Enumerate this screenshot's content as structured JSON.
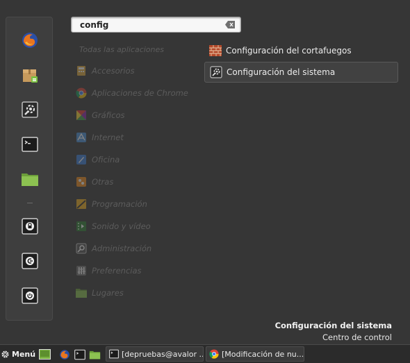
{
  "search": {
    "value": "config",
    "clear_icon": "backspace-clear-icon"
  },
  "favorites": [
    {
      "name": "firefox",
      "icon": "firefox-icon"
    },
    {
      "name": "software-manager",
      "icon": "package-icon"
    },
    {
      "name": "system-settings",
      "icon": "settings-icon"
    },
    {
      "name": "terminal",
      "icon": "terminal-icon"
    },
    {
      "name": "files",
      "icon": "folder-icon"
    },
    {
      "name": "lock-screen",
      "icon": "lock-icon"
    },
    {
      "name": "logout",
      "icon": "logout-icon"
    },
    {
      "name": "shutdown",
      "icon": "power-icon"
    }
  ],
  "categories": {
    "all_label": "Todas las aplicaciones",
    "items": [
      {
        "label": "Accesorios",
        "icon": "accessories-icon"
      },
      {
        "label": "Aplicaciones de Chrome",
        "icon": "chrome-icon"
      },
      {
        "label": "Gráficos",
        "icon": "graphics-icon"
      },
      {
        "label": "Internet",
        "icon": "internet-icon"
      },
      {
        "label": "Oficina",
        "icon": "office-icon"
      },
      {
        "label": "Otras",
        "icon": "other-icon"
      },
      {
        "label": "Programación",
        "icon": "programming-icon"
      },
      {
        "label": "Sonido y vídeo",
        "icon": "multimedia-icon"
      },
      {
        "label": "Administración",
        "icon": "administration-icon"
      },
      {
        "label": "Preferencias",
        "icon": "preferences-icon"
      },
      {
        "label": "Lugares",
        "icon": "places-folder-icon"
      }
    ]
  },
  "results": [
    {
      "label": "Configuración del cortafuegos",
      "icon": "firewall-icon",
      "selected": false
    },
    {
      "label": "Configuración del sistema",
      "icon": "system-settings-icon",
      "selected": true
    }
  ],
  "description": {
    "title": "Configuración del sistema",
    "subtitle": "Centro de control"
  },
  "taskbar": {
    "menu_label": "Menú",
    "tasks": [
      {
        "label": "[depruebas@avalor ...",
        "icon": "terminal-icon"
      },
      {
        "label": "[Modificación de nu...",
        "icon": "chrome-icon"
      }
    ]
  }
}
